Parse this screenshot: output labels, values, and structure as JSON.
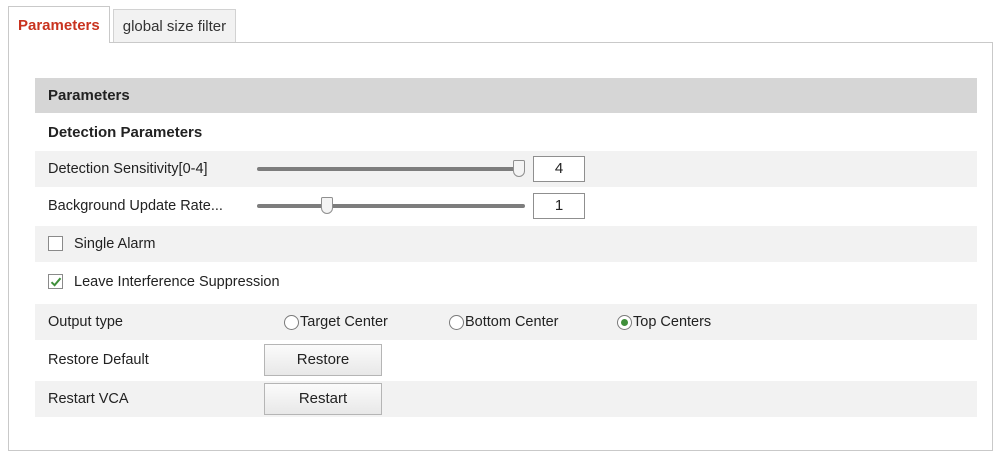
{
  "tabs": [
    {
      "label": "Parameters",
      "active": true
    },
    {
      "label": "global size filter",
      "active": false
    }
  ],
  "section": {
    "title": "Parameters"
  },
  "detection": {
    "heading": "Detection Parameters"
  },
  "sensitivity": {
    "label": "Detection Sensitivity[0-4]",
    "value": "4",
    "min": 0,
    "max": 4
  },
  "background_rate": {
    "label": "Background Update Rate...",
    "value": "1",
    "min": 0,
    "max": 4
  },
  "single_alarm": {
    "label": "Single Alarm",
    "checked": false
  },
  "leave_interference": {
    "label": "Leave Interference Suppression",
    "checked": true
  },
  "output_type": {
    "label": "Output type",
    "options": [
      "Target Center",
      "Bottom Center",
      "Top Centers"
    ],
    "selected": "Top Centers"
  },
  "restore": {
    "label": "Restore Default",
    "button": "Restore"
  },
  "restart": {
    "label": "Restart VCA",
    "button": "Restart"
  },
  "colors": {
    "active_tab": "#c9331f",
    "checkmark": "#3f8f3a",
    "header_bg": "#d6d6d6",
    "row_shade": "#f2f2f2"
  }
}
